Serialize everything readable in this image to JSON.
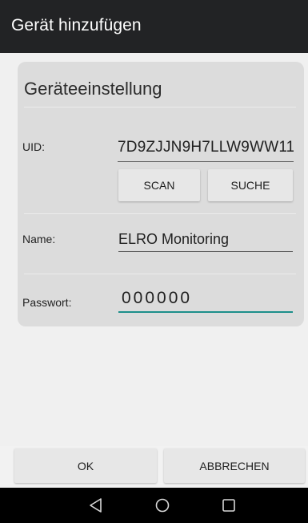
{
  "app_bar": {
    "title": "Gerät hinzufügen"
  },
  "card": {
    "title": "Geräteeinstellung",
    "uid": {
      "label": "UID:",
      "value": "7D9ZJJN9H7LLW9WW11"
    },
    "scan_label": "SCAN",
    "suche_label": "SUCHE",
    "name": {
      "label": "Name:",
      "value": "ELRO Monitoring"
    },
    "password": {
      "label": "Passwort:",
      "value": "000000"
    }
  },
  "footer": {
    "ok_label": "OK",
    "cancel_label": "ABBRECHEN"
  },
  "nav_bar": {
    "icons": [
      "back-icon",
      "home-icon",
      "recent-apps-icon"
    ]
  },
  "colors": {
    "app_bar": "#222325",
    "card": "#dcdcdc",
    "accent": "#1d8f8a",
    "nav_bar": "#000000"
  }
}
